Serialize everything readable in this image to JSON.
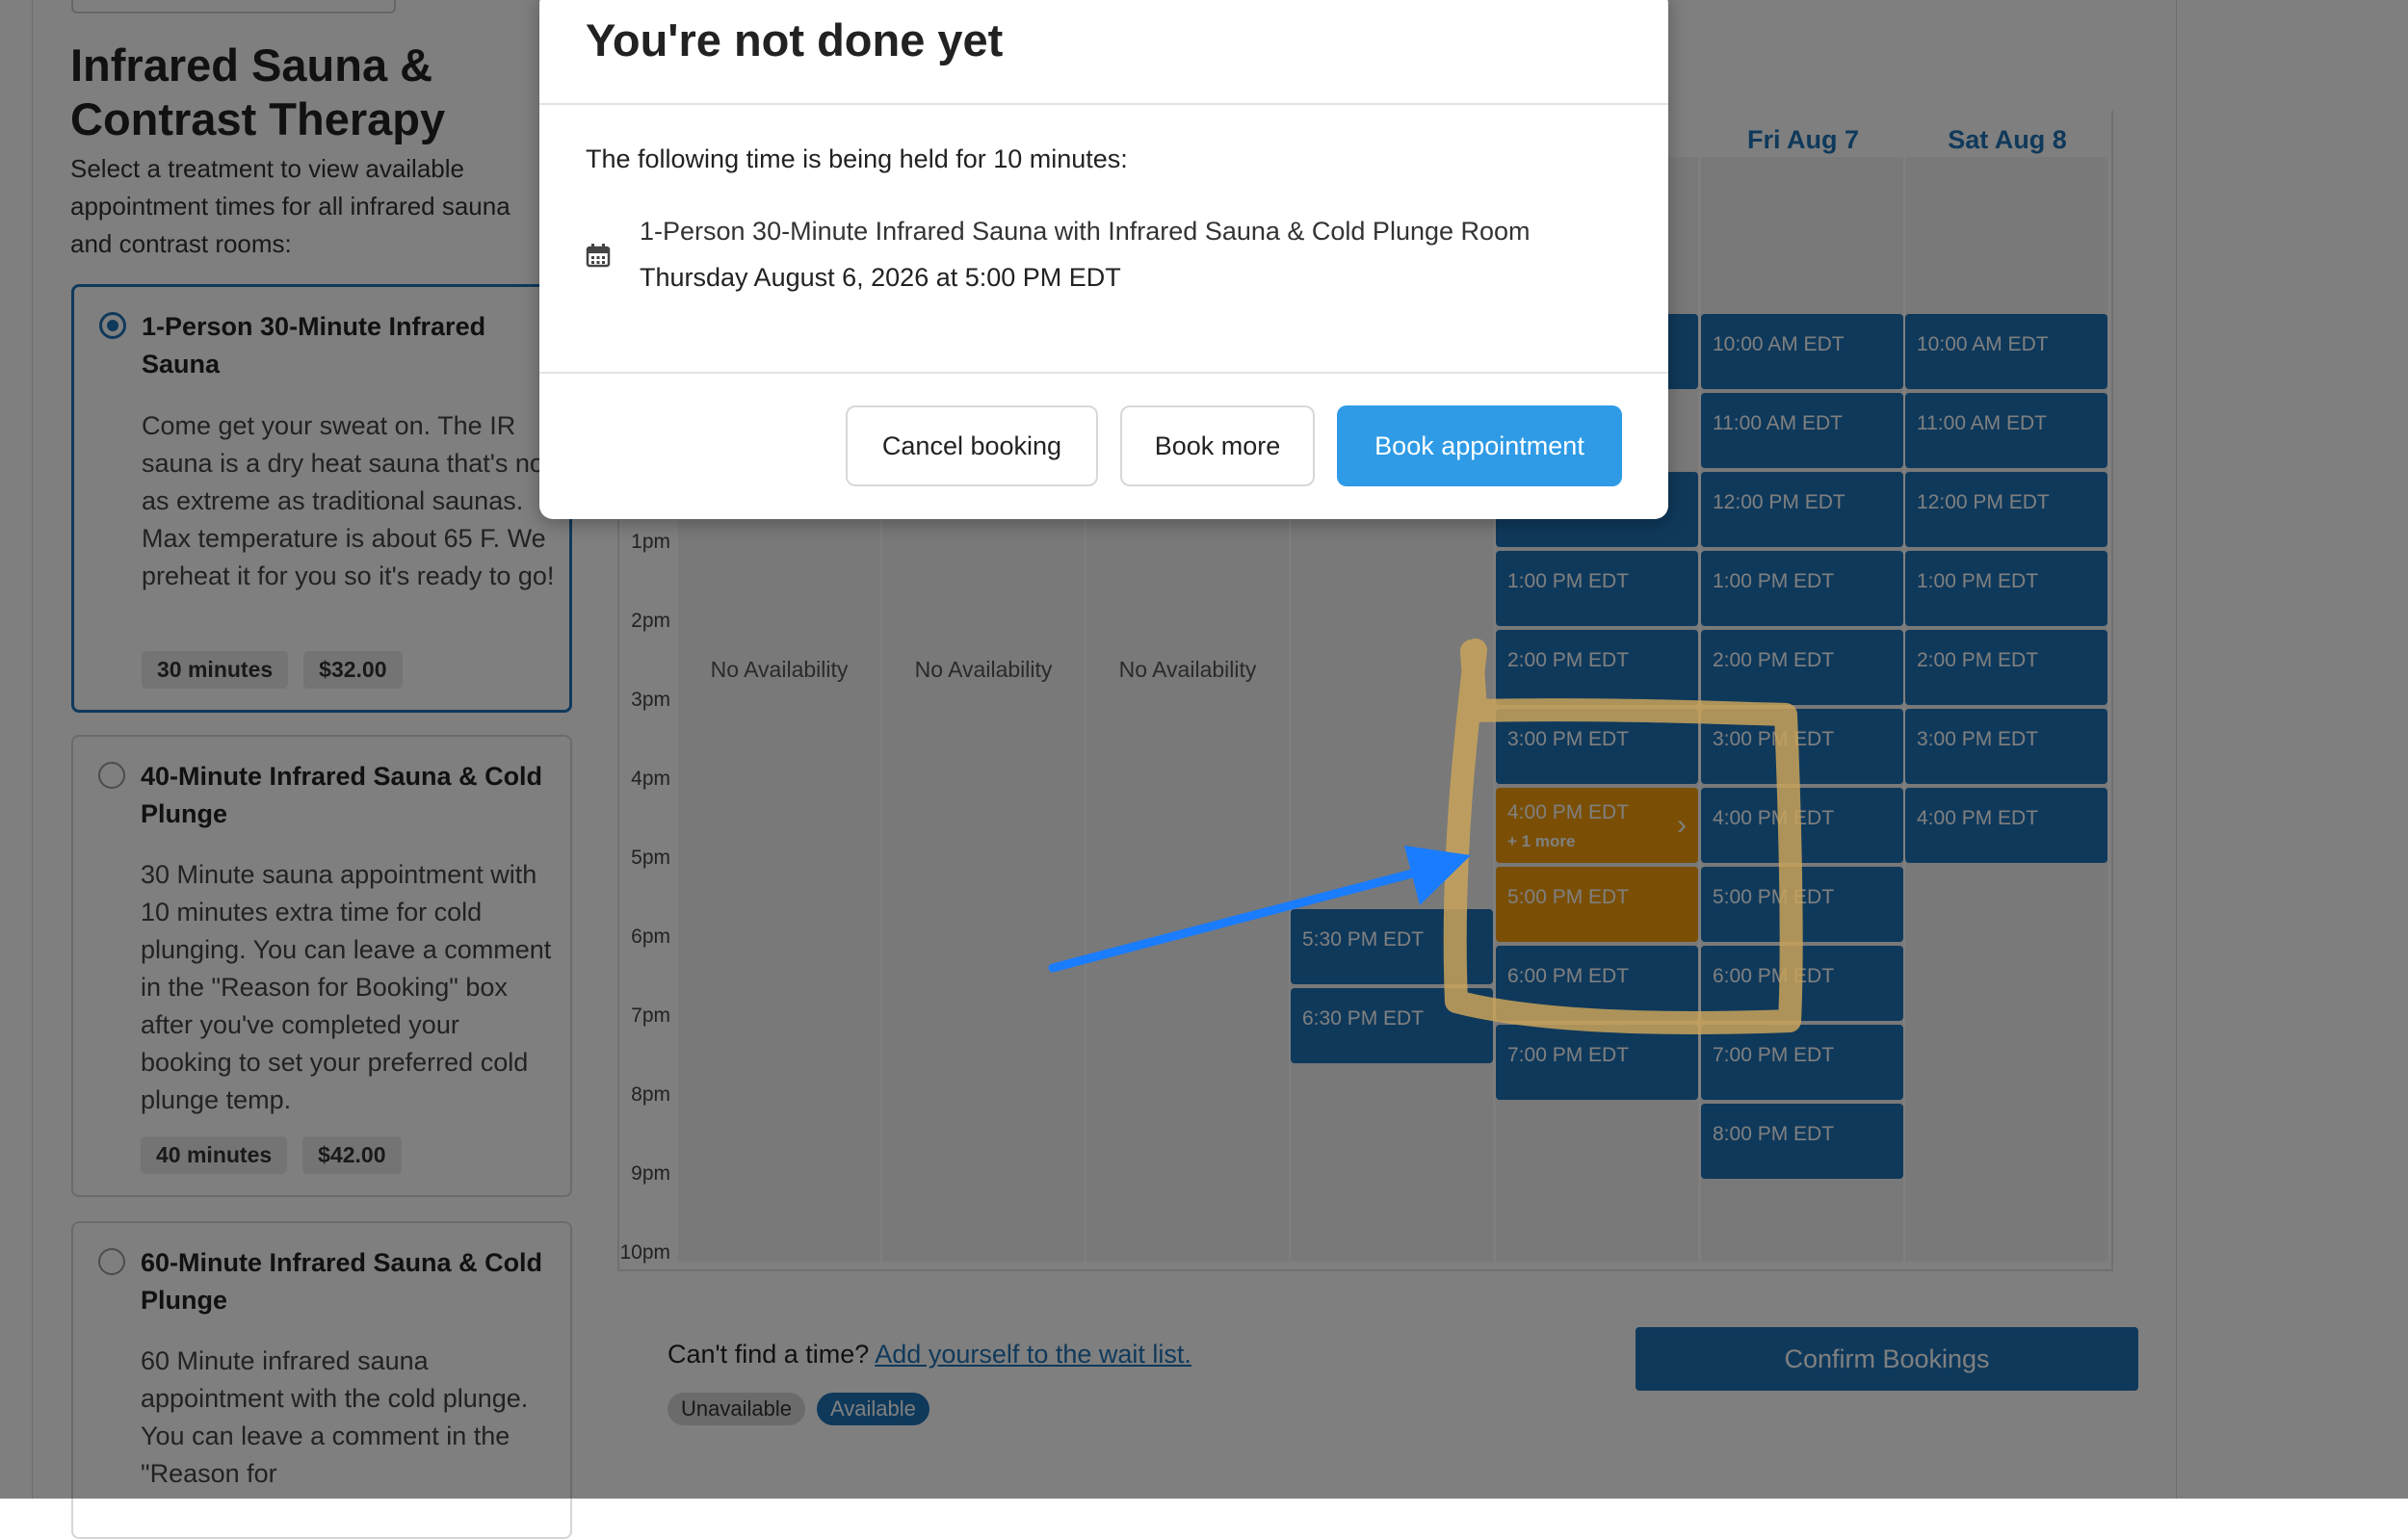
{
  "sidebar": {
    "title": "Infrared Sauna & Contrast Therapy",
    "subtitle": "Select a treatment to view available appointment times for all infrared sauna and contrast rooms:",
    "cards": [
      {
        "title": "1-Person 30-Minute Infrared Sauna",
        "description": "Come get your sweat on. The IR sauna is a dry heat sauna that's not as extreme as traditional saunas. Max temperature is about 65 F. We preheat it for you so it's ready to go!",
        "duration": "30 minutes",
        "price": "$32.00",
        "selected": true
      },
      {
        "title": "40-Minute Infrared Sauna & Cold Plunge",
        "description": "30 Minute sauna appointment with 10 minutes extra time for cold plunging. You can leave a comment in the \"Reason for Booking\" box after you've completed your booking to set your preferred cold plunge temp.",
        "duration": "40 minutes",
        "price": "$42.00",
        "selected": false
      },
      {
        "title": "60-Minute Infrared Sauna & Cold Plunge",
        "description": "60 Minute infrared sauna appointment with the cold plunge. You can leave a comment in the \"Reason for",
        "selected": false
      }
    ]
  },
  "calendar": {
    "day_headers": [
      "Fri Aug 7",
      "Sat Aug 8"
    ],
    "time_labels": [
      "1pm",
      "2pm",
      "3pm",
      "4pm",
      "5pm",
      "6pm",
      "7pm",
      "8pm",
      "9pm",
      "10pm"
    ],
    "no_availability": "No Availability",
    "thu_slots": [
      "5:30 PM EDT",
      "6:30 PM EDT"
    ],
    "wed_slots": [
      "1:00 PM EDT",
      "2:00 PM EDT",
      "3:00 PM EDT",
      "4:00 PM EDT",
      "5:00 PM EDT",
      "6:00 PM EDT",
      "7:00 PM EDT"
    ],
    "held_more": "+ 1 more",
    "fri_slots": [
      "10:00 AM EDT",
      "11:00 AM EDT",
      "12:00 PM EDT",
      "1:00 PM EDT",
      "2:00 PM EDT",
      "3:00 PM EDT",
      "4:00 PM EDT",
      "5:00 PM EDT",
      "6:00 PM EDT",
      "7:00 PM EDT",
      "8:00 PM EDT"
    ],
    "sat_slots": [
      "10:00 AM EDT",
      "11:00 AM EDT",
      "12:00 PM EDT",
      "1:00 PM EDT",
      "2:00 PM EDT",
      "3:00 PM EDT",
      "4:00 PM EDT"
    ]
  },
  "footer": {
    "cant_find": "Can't find a time?",
    "wait_list_link": "Add yourself to the wait list.",
    "confirm_label": "Confirm Bookings",
    "legend_unavailable": "Unavailable",
    "legend_available": "Available"
  },
  "modal": {
    "title": "You're not done yet",
    "lead": "The following time is being held for 10 minutes:",
    "booking_name": "1-Person 30-Minute Infrared Sauna with Infrared Sauna & Cold Plunge Room",
    "booking_date": "Thursday August 6, 2026 at 5:00 PM EDT",
    "cancel_label": "Cancel booking",
    "book_more_label": "Book more",
    "book_label": "Book appointment"
  },
  "colors": {
    "accent": "#1f73b7",
    "held": "#f59e0b",
    "primary_button": "#2f9be6"
  },
  "icons": {
    "booking": "calendar-icon",
    "held_slot": "chevron-right-icon"
  }
}
